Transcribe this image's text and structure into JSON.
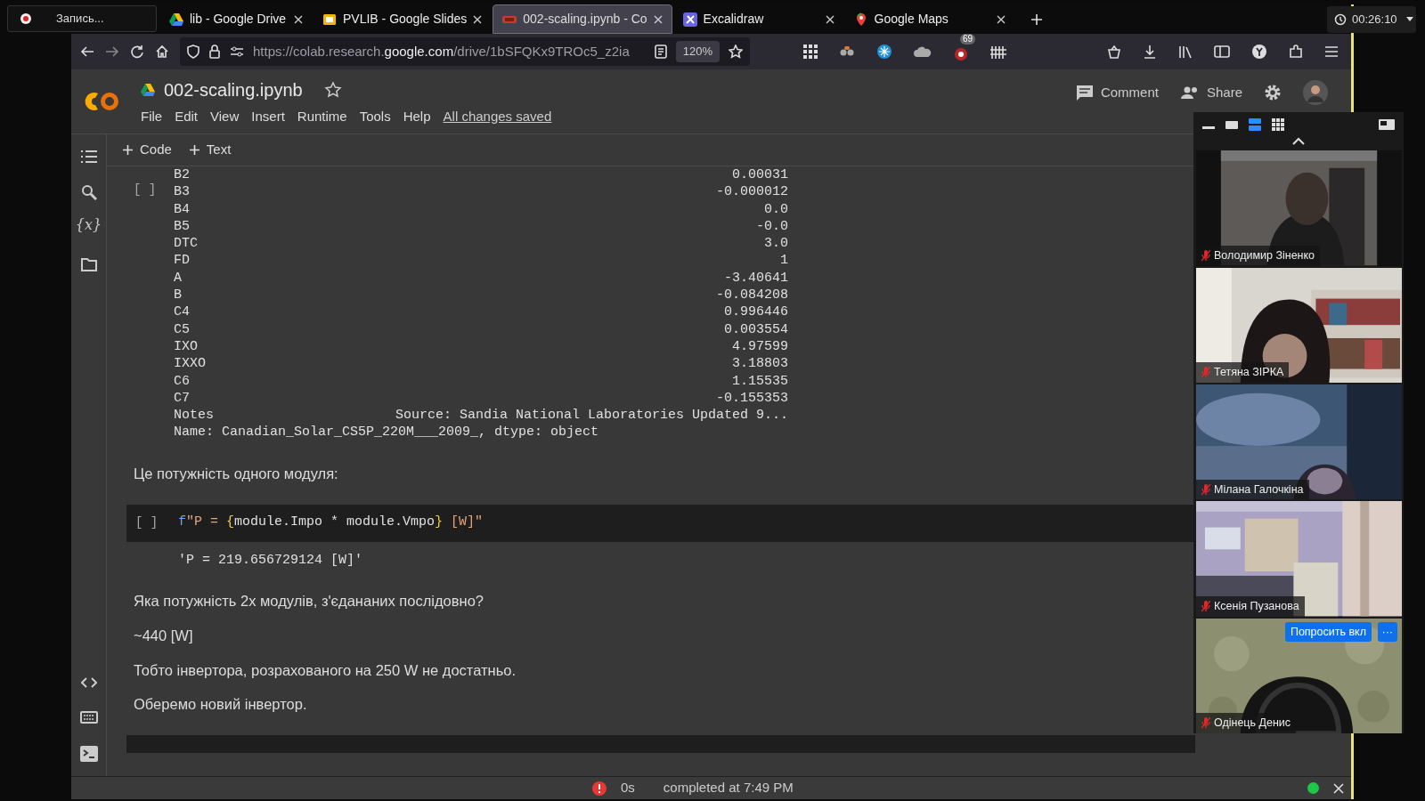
{
  "recorder": {
    "label": "Запись..."
  },
  "timer": {
    "text": "00:26:10"
  },
  "tabs": [
    {
      "title": "lib - Google Drive",
      "kind": "drive",
      "selected": false
    },
    {
      "title": "PVLIB - Google Slides",
      "kind": "slides",
      "selected": false
    },
    {
      "title": "002-scaling.ipynb - Co",
      "kind": "colab",
      "selected": true
    },
    {
      "title": "Excalidraw",
      "kind": "excalidraw",
      "selected": false
    },
    {
      "title": "Google Maps",
      "kind": "maps",
      "selected": false
    }
  ],
  "address_bar": {
    "url": "https://colab.research.**google.com**/drive/1bSFQKx9TROc5_z2ia",
    "zoom": "120%",
    "extension_badge": "69"
  },
  "notebook": {
    "title": "002-scaling.ipynb",
    "starred": false,
    "menu": [
      "File",
      "Edit",
      "View",
      "Insert",
      "Runtime",
      "Tools",
      "Help"
    ],
    "save_status": "All changes saved",
    "actions": [
      {
        "label": "Comment",
        "kind": "comment"
      },
      {
        "label": "Share",
        "kind": "share"
      }
    ]
  },
  "toolbar": [
    "Code",
    "Text"
  ],
  "sidebar": {
    "variables_glyph": "{x}"
  },
  "cells": [
    {
      "kind": "output",
      "bracket": "[ ]",
      "rows": [
        {
          "key": "B2",
          "value": "0.00031"
        },
        {
          "key": "B3",
          "value": "-0.000012"
        },
        {
          "key": "B4",
          "value": "0.0"
        },
        {
          "key": "B5",
          "value": "-0.0"
        },
        {
          "key": "DTC",
          "value": "3.0"
        },
        {
          "key": "FD",
          "value": "1"
        },
        {
          "key": "A",
          "value": "-3.40641"
        },
        {
          "key": "B",
          "value": "-0.084208"
        },
        {
          "key": "C4",
          "value": "0.996446"
        },
        {
          "key": "C5",
          "value": "0.003554"
        },
        {
          "key": "IXO",
          "value": "4.97599"
        },
        {
          "key": "IXXO",
          "value": "3.18803"
        },
        {
          "key": "C6",
          "value": "1.15535"
        },
        {
          "key": "C7",
          "value": "-0.155353"
        },
        {
          "key": "Notes",
          "value": "Source: Sandia National Laboratories Updated 9..."
        }
      ],
      "footer": "Name: Canadian_Solar_CS5P_220M___2009_, dtype: object"
    },
    {
      "kind": "text",
      "paragraphs": [
        "Це потужність одного модуля:"
      ]
    },
    {
      "kind": "code",
      "bracket": "[ ]",
      "tokens": [
        {
          "text": "f",
          "kind": "prefix"
        },
        {
          "text": "\"P = ",
          "kind": "string"
        },
        {
          "text": "{",
          "kind": "brace"
        },
        {
          "text": "module.Impo * module.Vmpo",
          "kind": "plain"
        },
        {
          "text": "}",
          "kind": "brace"
        },
        {
          "text": " [W]\"",
          "kind": "string"
        }
      ],
      "output": "'P = 219.656729124 [W]'"
    },
    {
      "kind": "text",
      "paragraphs": [
        "Яка потужність 2х модулів, з'єдананих послідовно?",
        "~440 [W]",
        "Тобто інвертора, розрахованого на 250 W не достатньо.",
        "Оберемо новий інвертор."
      ]
    }
  ],
  "status_bar": {
    "duration": "0s",
    "message": "completed at 7:49 PM",
    "error": true,
    "connected": true
  },
  "participants": [
    {
      "name": "Володимир Зіненко",
      "muted": true
    },
    {
      "name": "Тетяна ЗІРКА",
      "muted": true
    },
    {
      "name": "Мілана Галочкіна",
      "muted": true
    },
    {
      "name": "Ксенія Пузанова",
      "muted": true
    },
    {
      "name": "Одінець Денис",
      "muted": true,
      "ask_button": "Попросить вкл",
      "more_button": "···"
    }
  ]
}
